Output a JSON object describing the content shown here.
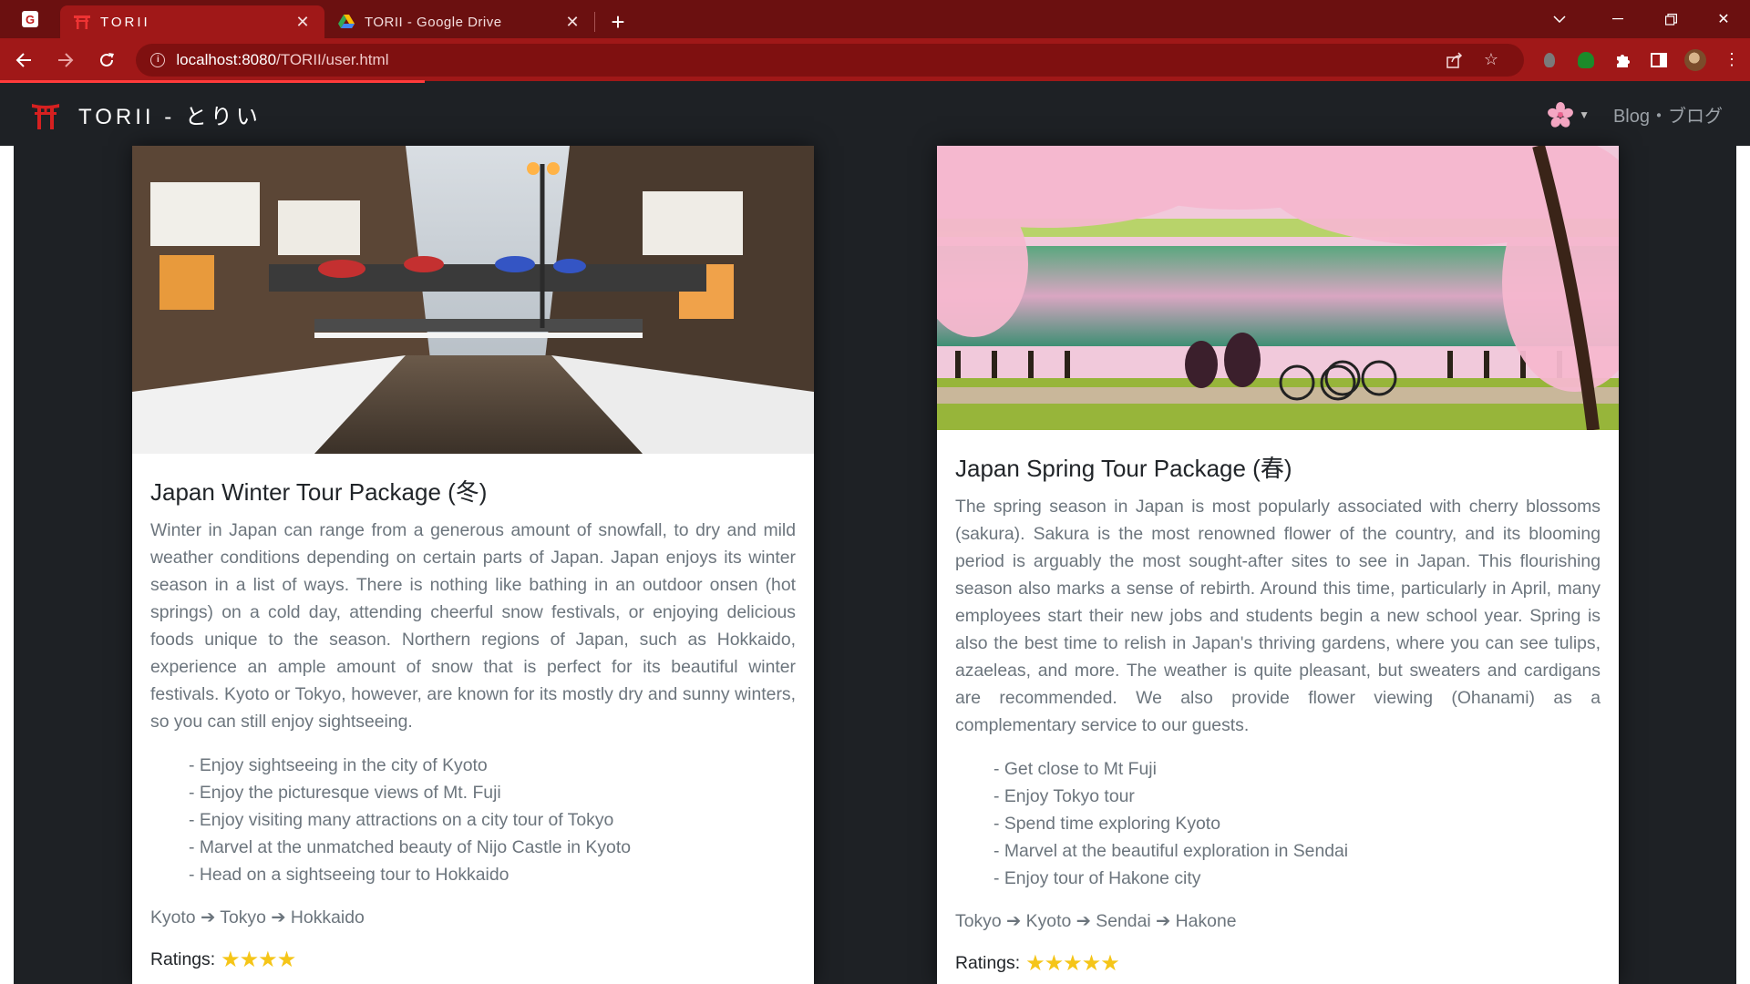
{
  "browser": {
    "tabs": [
      {
        "title": "TORII",
        "active": true
      },
      {
        "title": "TORII - Google Drive",
        "active": false
      }
    ],
    "url": {
      "host": "localhost:8080",
      "path": "/TORII/user.html"
    }
  },
  "site": {
    "brand": "TORII - とりい",
    "nav_link": "Blog・ブログ"
  },
  "cards": [
    {
      "title": "Japan Winter Tour Package (冬)",
      "description": "Winter in Japan can range from a generous amount of snowfall, to dry and mild weather conditions depending on certain parts of Japan. Japan enjoys its winter season in a list of ways. There is nothing like bathing in an outdoor onsen (hot springs) on a cold day, attending cheerful snow festivals, or enjoying delicious foods unique to the season. Northern regions of Japan, such as Hokkaido, experience an ample amount of snow that is perfect for its beautiful winter festivals. Kyoto or Tokyo, however, are known for its mostly dry and sunny winters, so you can still enjoy sightseeing.",
      "highlights": [
        "- Enjoy sightseeing in the city of Kyoto",
        "- Enjoy the picturesque views of Mt. Fuji",
        "- Enjoy visiting many attractions on a city tour of Tokyo",
        "- Marvel at the unmatched beauty of Nijo Castle in Kyoto",
        "- Head on a sightseeing tour to Hokkaido"
      ],
      "route": "Kyoto ➔ Tokyo ➔ Hokkaido",
      "ratings_label": "Ratings:",
      "rating": 4
    },
    {
      "title": "Japan Spring Tour Package (春)",
      "description": "The spring season in Japan is most popularly associated with cherry blossoms (sakura). Sakura is the most renowned flower of the country, and its blooming period is arguably the most sought-after sites to see in Japan. This flourishing season also marks a sense of rebirth. Around this time, particularly in April, many employees start their new jobs and students begin a new school year. Spring is also the best time to relish in Japan's thriving gardens, where you can see tulips, azaeleas, and more. The weather is quite pleasant, but sweaters and cardigans are recommended. We also provide flower viewing (Ohanami) as a complementary service to our guests.",
      "highlights": [
        "- Get close to Mt Fuji",
        "- Enjoy Tokyo tour",
        "- Spend time exploring Kyoto",
        "- Marvel at the beautiful exploration in Sendai",
        "- Enjoy tour of Hakone city"
      ],
      "route": "Tokyo ➔ Kyoto ➔ Sendai ➔ Hakone",
      "ratings_label": "Ratings:",
      "rating": 5
    }
  ],
  "colors": {
    "chrome_dark": "#6b1010",
    "chrome_accent": "#a01818",
    "navbar": "#1e2125",
    "star": "#f5c518"
  }
}
